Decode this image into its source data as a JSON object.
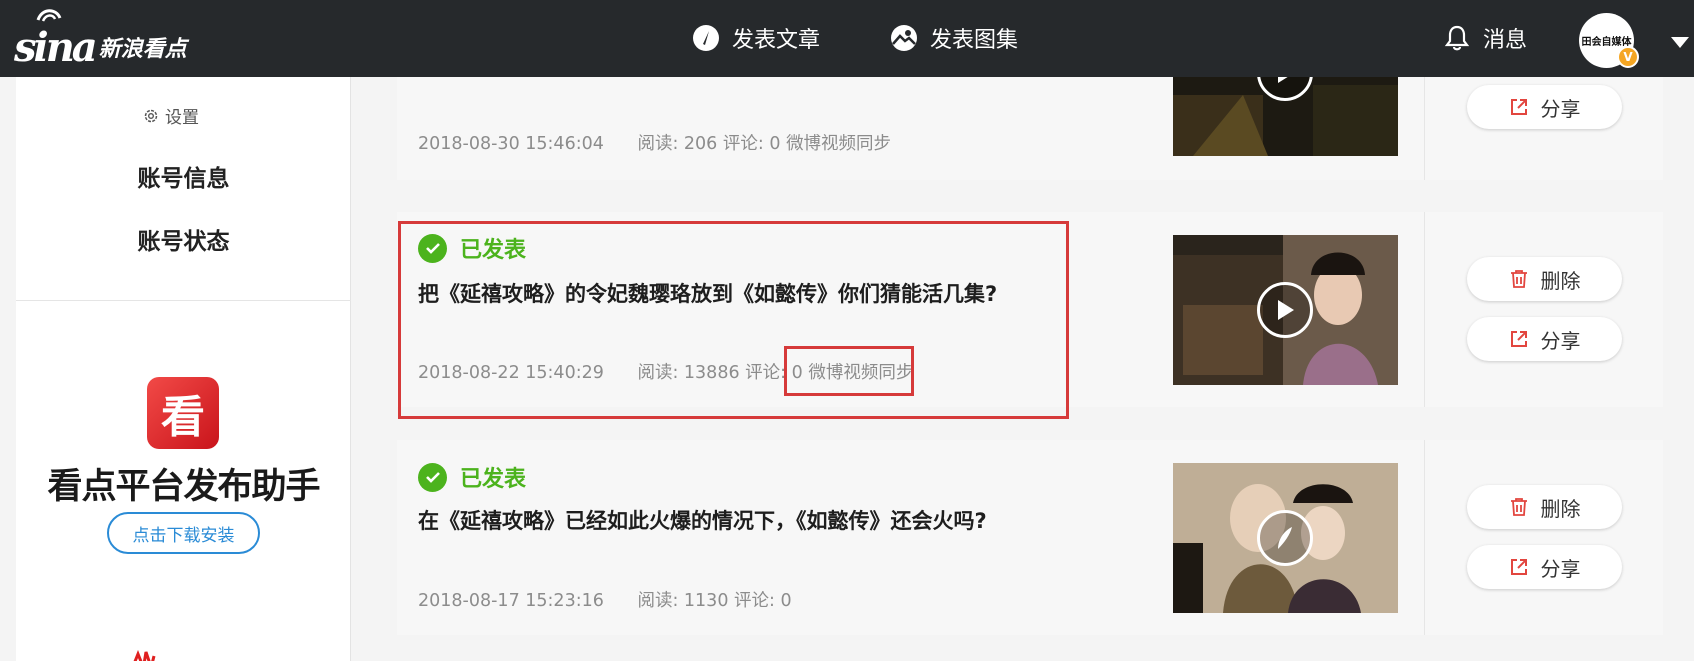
{
  "header": {
    "logo_text": "sina",
    "brand_name": "新浪看点",
    "nav": [
      {
        "label": "发表文章",
        "icon": "compass-pen-icon"
      },
      {
        "label": "发表图集",
        "icon": "image-gallery-icon"
      }
    ],
    "messages_label": "消息",
    "avatar_text": "田会自媒体",
    "verified_badge": "V"
  },
  "sidebar": {
    "settings_label": "设置",
    "items": [
      {
        "label": "账号信息"
      },
      {
        "label": "账号状态"
      }
    ],
    "promo": {
      "app_icon_char": "看",
      "title": "看点平台发布助手",
      "download_label": "点击下载安装"
    }
  },
  "posts": [
    {
      "date": "2018-08-30 15:46:04",
      "stats": "阅读: 206  评论: 0",
      "source": "微博视频同步",
      "actions": [
        {
          "label": "分享",
          "icon": "share-icon"
        }
      ]
    },
    {
      "status": "已发表",
      "title": "把《延禧攻略》的令妃魏璎珞放到《如懿传》你们猜能活几集?",
      "date": "2018-08-22 15:40:29",
      "stats": "阅读: 13886  评论: 0",
      "source": "微博视频同步",
      "actions": [
        {
          "label": "删除",
          "icon": "trash-icon"
        },
        {
          "label": "分享",
          "icon": "share-icon"
        }
      ]
    },
    {
      "status": "已发表",
      "title": "在《延禧攻略》已经如此火爆的情况下，《如懿传》还会火吗?",
      "date": "2018-08-17 15:23:16",
      "stats": "阅读: 1130  评论: 0",
      "actions": [
        {
          "label": "删除",
          "icon": "trash-icon"
        },
        {
          "label": "分享",
          "icon": "share-icon"
        }
      ]
    }
  ],
  "colors": {
    "topbar": "#26292c",
    "published_green": "#4cb31d",
    "action_red": "#e2463f",
    "download_blue": "#2a8bd6",
    "highlight_red": "#d63a3a"
  }
}
